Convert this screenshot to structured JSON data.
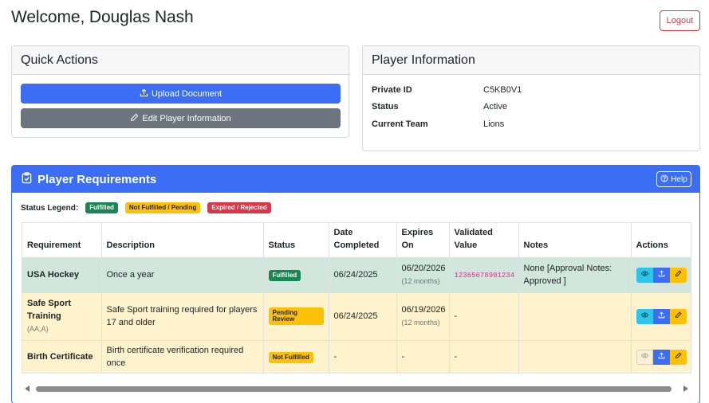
{
  "header": {
    "welcome": "Welcome, Douglas Nash",
    "logout_label": "Logout"
  },
  "quick_actions": {
    "title": "Quick Actions",
    "upload_label": "Upload Document",
    "edit_label": "Edit Player Information"
  },
  "player_info": {
    "title": "Player Information",
    "rows": [
      {
        "key": "Private ID",
        "value": "C5KB0V1"
      },
      {
        "key": "Status",
        "value": "Active"
      },
      {
        "key": "Current Team",
        "value": "Lions"
      }
    ]
  },
  "requirements": {
    "title": "Player Requirements",
    "help_label": "Help",
    "legend_label": "Status Legend:",
    "legend": [
      "Fulfilled",
      "Not Fulfilled / Pending",
      "Expired / Rejected"
    ],
    "columns": [
      "Requirement",
      "Description",
      "Status",
      "Date Completed",
      "Expires On",
      "Validated Value",
      "Notes",
      "Actions"
    ],
    "rows": [
      {
        "requirement": "USA Hockey",
        "requirement_sub": "",
        "description": "Once a year",
        "status": "Fulfilled",
        "date_completed": "06/24/2025",
        "expires_on": "06/20/2026",
        "expires_sub": "(12 months)",
        "validated_value": "12365678901234",
        "notes": "None [Approval Notes: Approved ]"
      },
      {
        "requirement": "Safe Sport Training",
        "requirement_sub": "(AA,A)",
        "description": "Safe Sport training required for players 17 and older",
        "status": "Pending Review",
        "date_completed": "06/24/2025",
        "expires_on": "06/19/2026",
        "expires_sub": "(12 months)",
        "validated_value": "-",
        "notes": ""
      },
      {
        "requirement": "Birth Certificate",
        "requirement_sub": "",
        "description": "Birth certificate verification required once",
        "status": "Not Fulfilled",
        "date_completed": "-",
        "expires_on": "-",
        "expires_sub": "",
        "validated_value": "-",
        "notes": ""
      }
    ]
  },
  "colors": {
    "primary": "#3b6ef5",
    "success": "#198754",
    "warning": "#ffc107",
    "danger": "#dc3545",
    "info": "#2ec5ea",
    "secondary": "#6c757d"
  },
  "icons": {
    "upload": "upload-icon",
    "edit": "pencil-icon",
    "clipboard": "clipboard-check-icon",
    "help": "question-circle-icon",
    "view": "eye-icon"
  }
}
